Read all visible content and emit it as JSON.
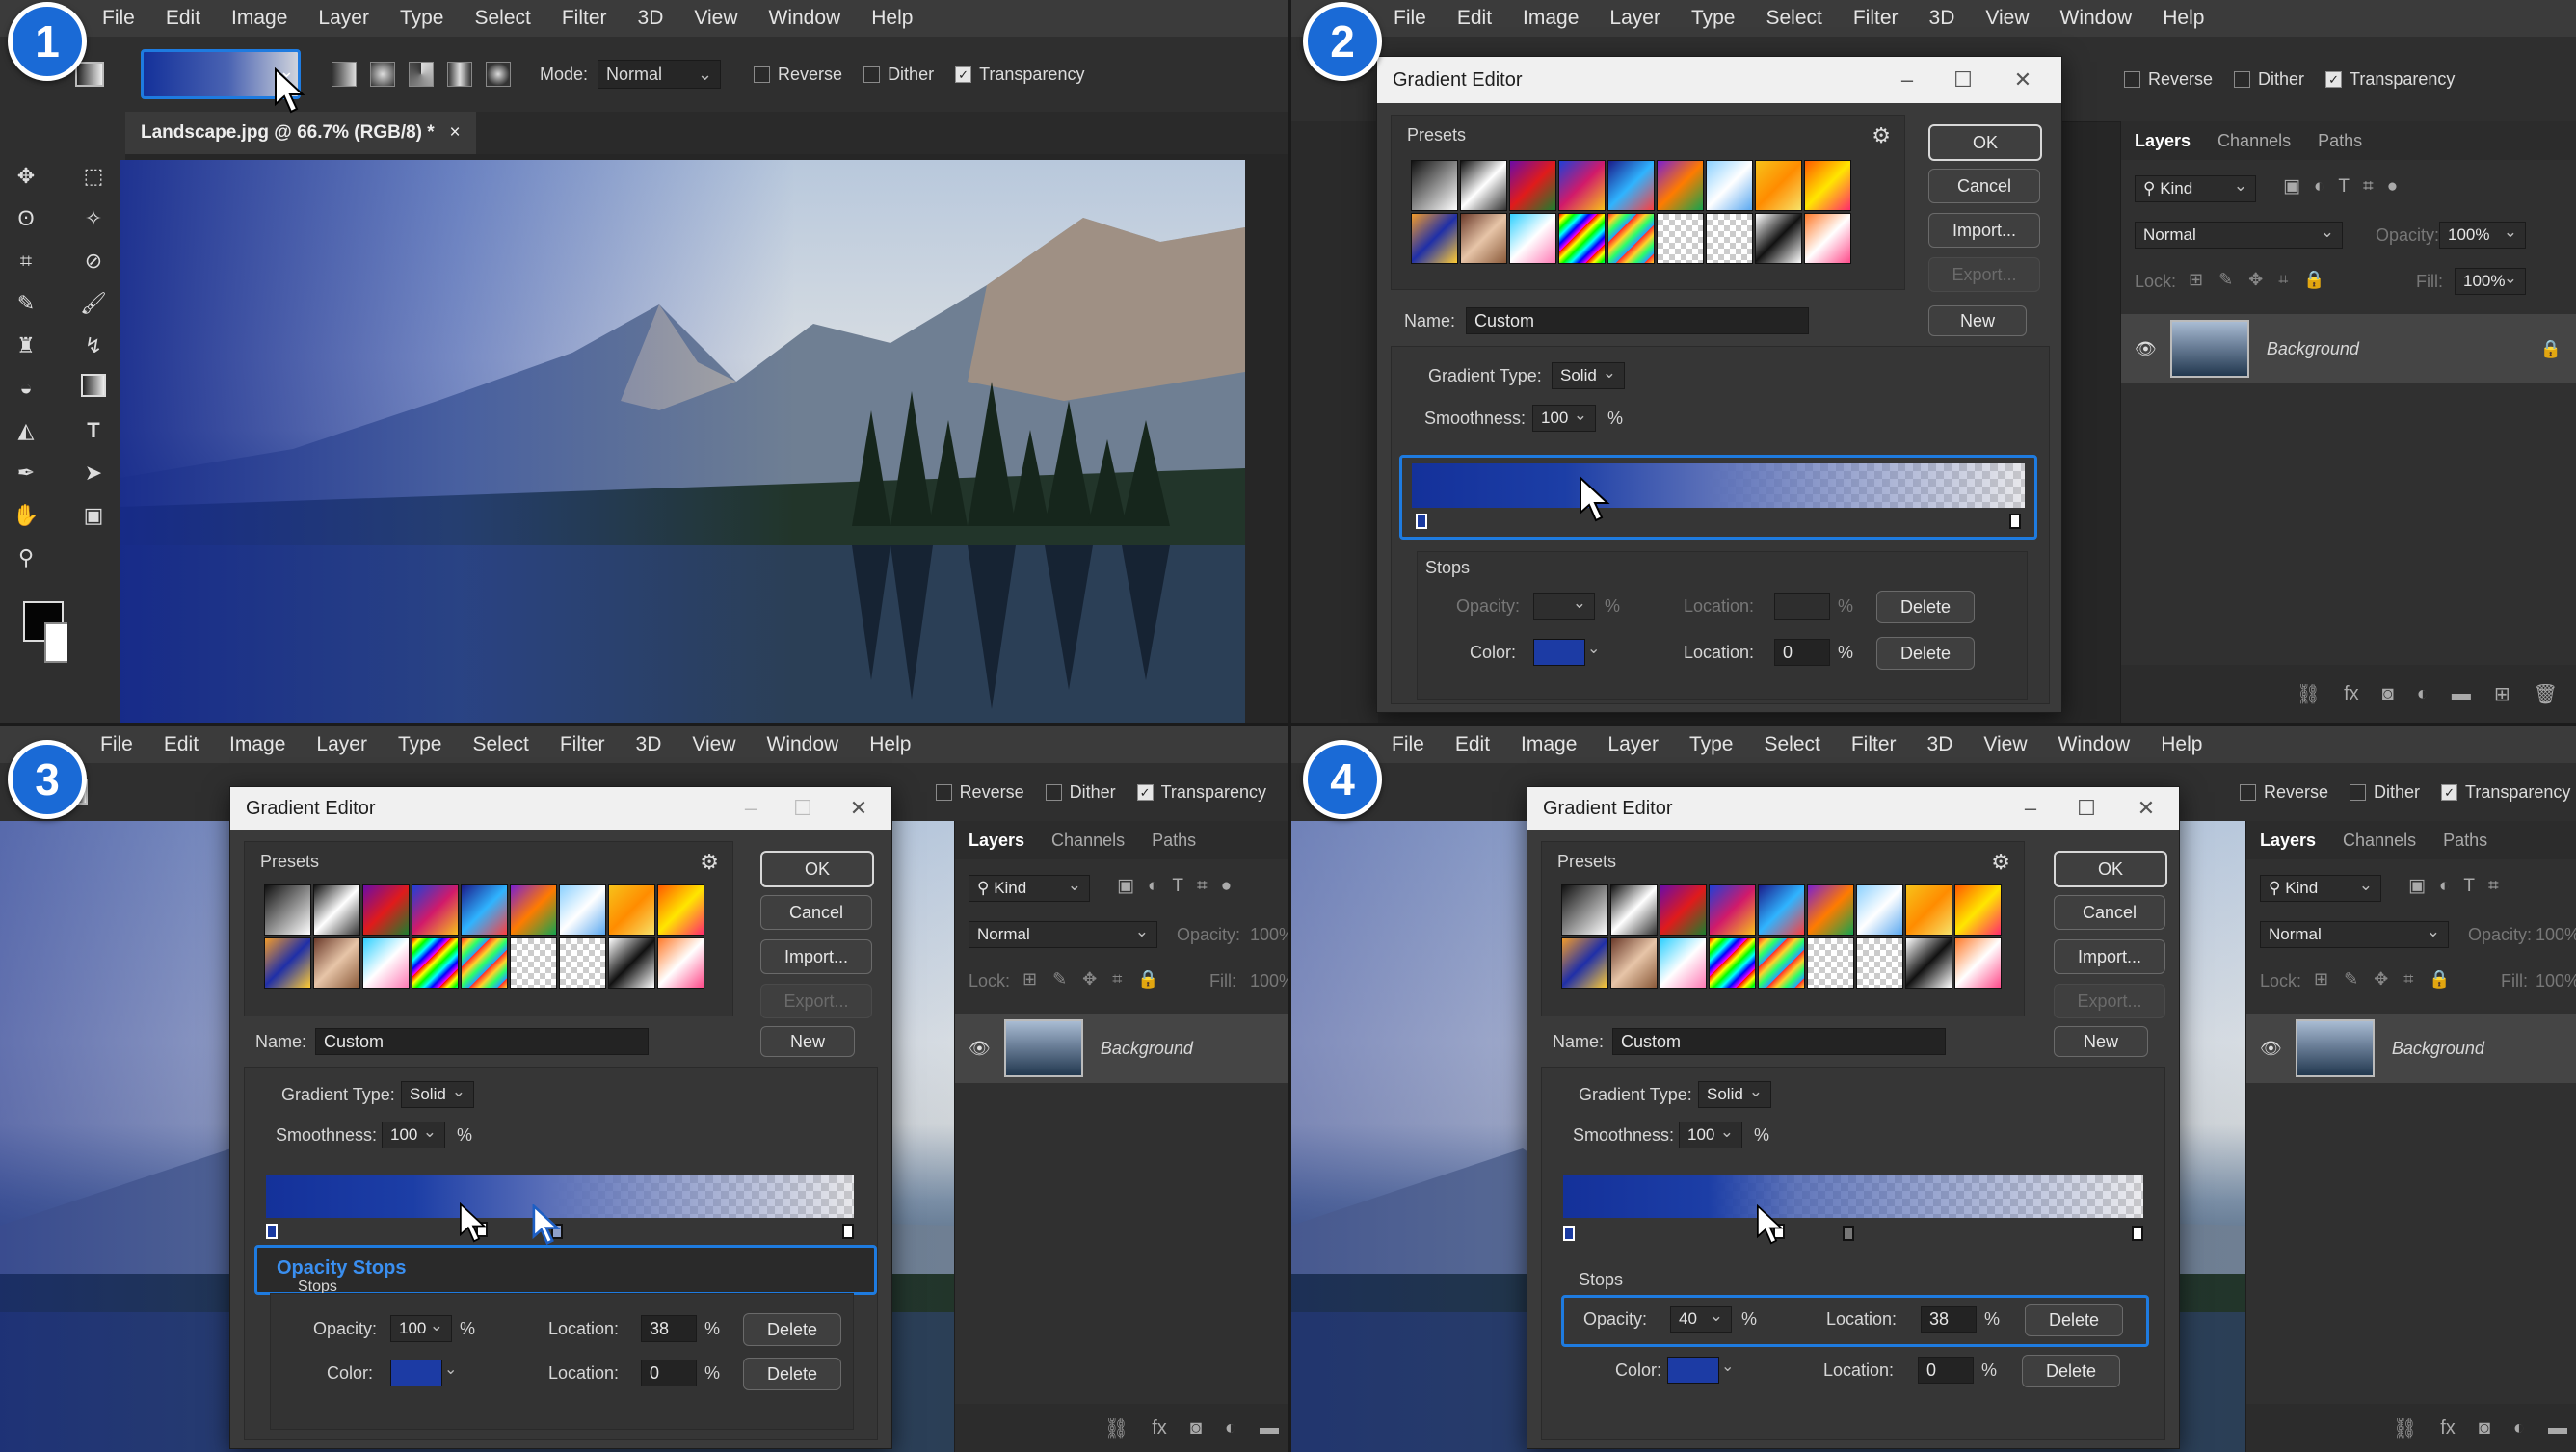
{
  "menu": [
    "File",
    "Edit",
    "Image",
    "Layer",
    "Type",
    "Select",
    "Filter",
    "3D",
    "View",
    "Window",
    "Help"
  ],
  "badges": [
    "1",
    "2",
    "3",
    "4"
  ],
  "options": {
    "mode_label": "Mode:",
    "mode_value": "Normal",
    "reverse": "Reverse",
    "dither": "Dither",
    "transparency": "Transparency"
  },
  "document_tab": "Landscape.jpg @ 66.7% (RGB/8) *",
  "dialog": {
    "title": "Gradient Editor",
    "presets": "Presets",
    "ok": "OK",
    "cancel": "Cancel",
    "import": "Import...",
    "export": "Export...",
    "name_label": "Name:",
    "name_value": "Custom",
    "new": "New",
    "gradient_type_label": "Gradient Type:",
    "gradient_type_value": "Solid",
    "smoothness_label": "Smoothness:",
    "smoothness_value": "100",
    "percent": "%",
    "stops": "Stops",
    "opacity_label": "Opacity:",
    "color_label": "Color:",
    "location_label": "Location:",
    "delete": "Delete",
    "opacity_stops_tooltip": "Opacity Stops"
  },
  "panel2_stops": {
    "color_location": "0"
  },
  "panel3_stops": {
    "opacity": "100",
    "opacity_location": "38",
    "color_location": "0"
  },
  "panel4_stops": {
    "opacity": "40",
    "opacity_location": "38",
    "color_location": "0"
  },
  "layers": {
    "tab_layers": "Layers",
    "tab_channels": "Channels",
    "tab_paths": "Paths",
    "kind": "Kind",
    "blend": "Normal",
    "opacity_label": "Opacity:",
    "opacity_value": "100%",
    "lock_label": "Lock:",
    "fill_label": "Fill:",
    "fill_value": "100%",
    "layer_name": "Background"
  },
  "colors": {
    "accent": "#1e7be0",
    "gradient_start": "#14319a",
    "badge": "#1a6ad6"
  }
}
